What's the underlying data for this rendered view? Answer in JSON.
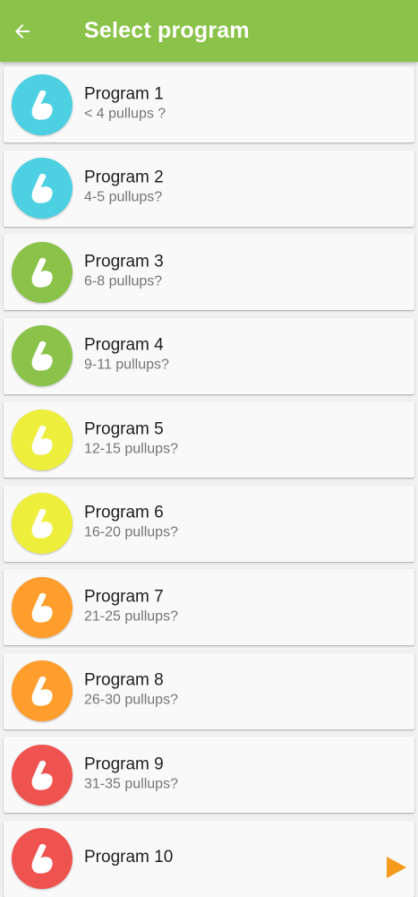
{
  "appbar": {
    "title": "Select program",
    "color": "#8bc34a"
  },
  "programs": [
    {
      "name": "Program 1",
      "subtitle": "< 4 pullups ?",
      "color": "#4dd0e1"
    },
    {
      "name": "Program 2",
      "subtitle": "4-5 pullups?",
      "color": "#4dd0e1"
    },
    {
      "name": "Program 3",
      "subtitle": "6-8 pullups?",
      "color": "#8bc34a"
    },
    {
      "name": "Program 4",
      "subtitle": "9-11 pullups?",
      "color": "#8bc34a"
    },
    {
      "name": "Program 5",
      "subtitle": "12-15 pullups?",
      "color": "#eeee3c"
    },
    {
      "name": "Program 6",
      "subtitle": "16-20 pullups?",
      "color": "#eeee3c"
    },
    {
      "name": "Program 7",
      "subtitle": "21-25 pullups?",
      "color": "#ff9e2c"
    },
    {
      "name": "Program 8",
      "subtitle": "26-30 pullups?",
      "color": "#ff9e2c"
    },
    {
      "name": "Program 9",
      "subtitle": "31-35 pullups?",
      "color": "#ef5350"
    },
    {
      "name": "Program 10",
      "subtitle": "",
      "color": "#ef5350"
    }
  ],
  "icons": {
    "back": "arrow-left-icon",
    "program": "flexed-bicep-icon",
    "ad": "play-triangle-icon"
  },
  "accent_colors": {
    "play": "#f59a1b"
  }
}
